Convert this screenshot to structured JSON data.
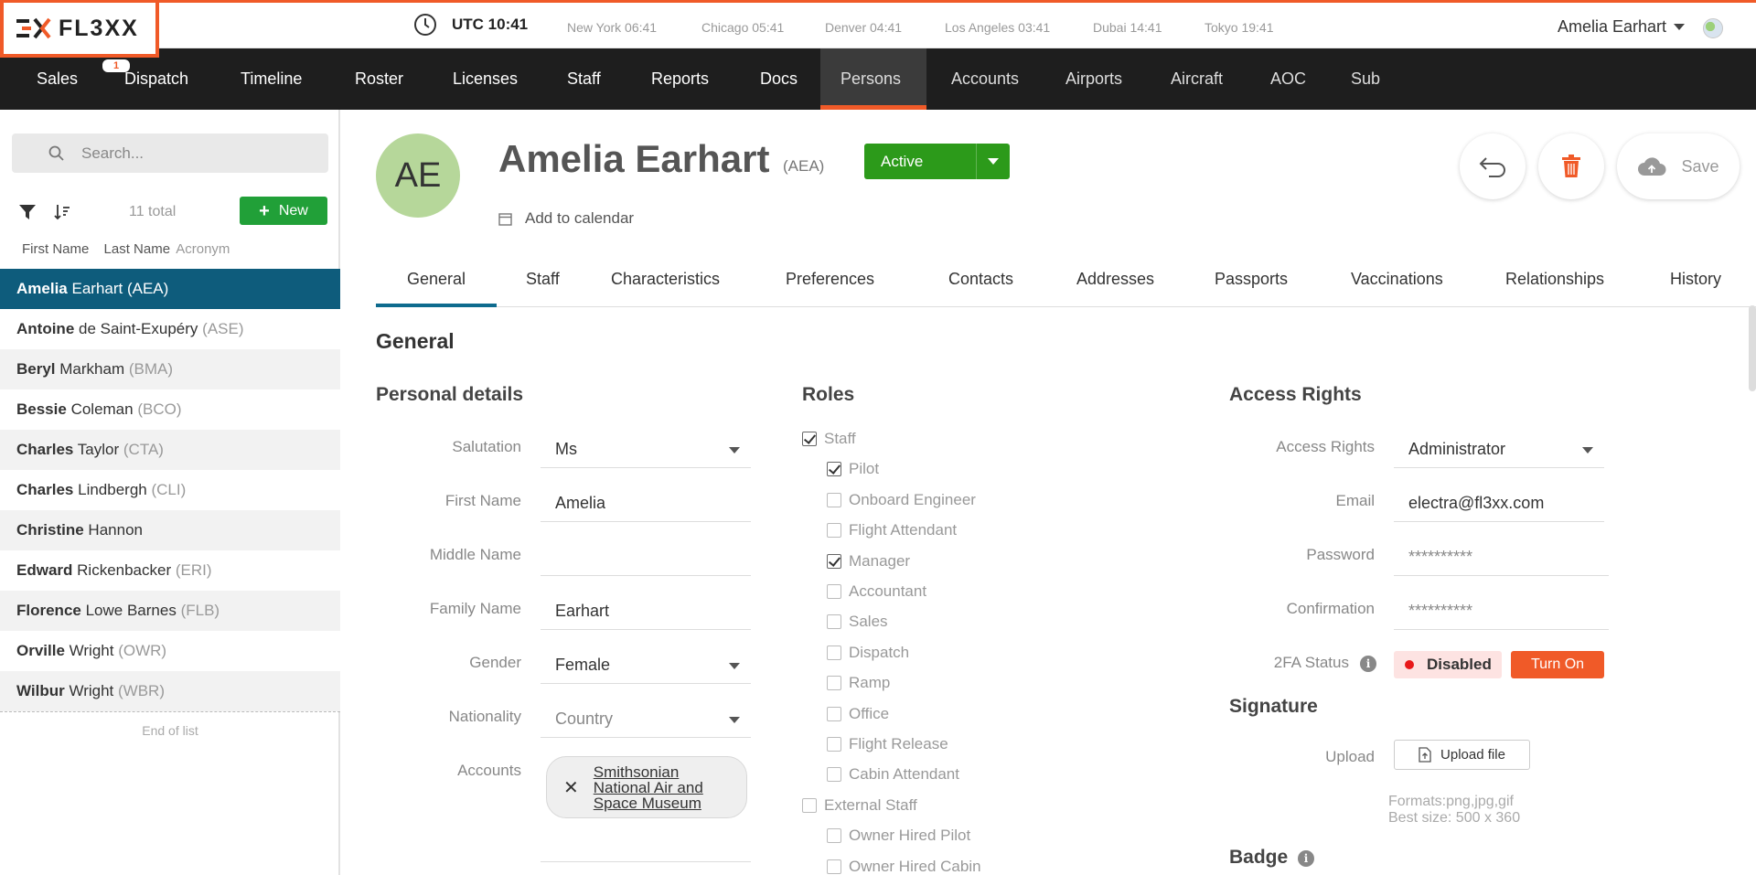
{
  "brand": {
    "logo_text": "FL3XX",
    "accent": "#f05a28"
  },
  "topbar": {
    "utc": "UTC 10:41",
    "timezones": [
      "New York 06:41",
      "Chicago 05:41",
      "Denver 04:41",
      "Los Angeles 03:41",
      "Dubai 14:41",
      "Tokyo 19:41"
    ],
    "user": "Amelia Earhart"
  },
  "nav": {
    "items": [
      "Sales",
      "Dispatch",
      "Timeline",
      "Roster",
      "Licenses",
      "Staff",
      "Reports",
      "Docs",
      "Persons",
      "Accounts",
      "Airports",
      "Aircraft",
      "AOC",
      "Sub"
    ],
    "active": "Persons",
    "sales_badge": "1"
  },
  "sidebar": {
    "search_placeholder": "Search...",
    "total": "11 total",
    "new_label": "New",
    "columns": [
      "First Name",
      "Last Name",
      "Acronym"
    ],
    "persons": [
      {
        "first": "Amelia",
        "last": "Earhart",
        "acronym": "(AEA)"
      },
      {
        "first": "Antoine",
        "last": "de Saint-Exupéry",
        "acronym": "(ASE)"
      },
      {
        "first": "Beryl",
        "last": "Markham",
        "acronym": "(BMA)"
      },
      {
        "first": "Bessie",
        "last": "Coleman",
        "acronym": "(BCO)"
      },
      {
        "first": "Charles",
        "last": "Taylor",
        "acronym": "(CTA)"
      },
      {
        "first": "Charles",
        "last": "Lindbergh",
        "acronym": "(CLI)"
      },
      {
        "first": "Christine",
        "last": "Hannon",
        "acronym": ""
      },
      {
        "first": "Edward",
        "last": "Rickenbacker",
        "acronym": "(ERI)"
      },
      {
        "first": "Florence",
        "last": "Lowe Barnes",
        "acronym": "(FLB)"
      },
      {
        "first": "Orville",
        "last": "Wright",
        "acronym": "(OWR)"
      },
      {
        "first": "Wilbur",
        "last": "Wright",
        "acronym": "(WBR)"
      }
    ],
    "end_label": "End of list"
  },
  "person": {
    "initials": "AE",
    "name": "Amelia Earhart",
    "acronym": "(AEA)",
    "status": "Active",
    "calendar_label": "Add to calendar",
    "save_label": "Save"
  },
  "tabs": [
    "General",
    "Staff",
    "Characteristics",
    "Preferences",
    "Contacts",
    "Addresses",
    "Passports",
    "Vaccinations",
    "Relationships",
    "History"
  ],
  "section_title": "General",
  "personal": {
    "title": "Personal details",
    "salutation_label": "Salutation",
    "salutation": "Ms",
    "first_name_label": "First Name",
    "first_name": "Amelia",
    "middle_name_label": "Middle Name",
    "middle_name": "",
    "family_name_label": "Family Name",
    "family_name": "Earhart",
    "gender_label": "Gender",
    "gender": "Female",
    "nationality_label": "Nationality",
    "nationality_placeholder": "Country",
    "accounts_label": "Accounts",
    "account": "Smithsonian National Air and Space Museum"
  },
  "roles": {
    "title": "Roles",
    "items": [
      {
        "label": "Staff",
        "checked": true,
        "indent": 0
      },
      {
        "label": "Pilot",
        "checked": true,
        "indent": 1
      },
      {
        "label": "Onboard Engineer",
        "checked": false,
        "indent": 1
      },
      {
        "label": "Flight Attendant",
        "checked": false,
        "indent": 1
      },
      {
        "label": "Manager",
        "checked": true,
        "indent": 1
      },
      {
        "label": "Accountant",
        "checked": false,
        "indent": 1
      },
      {
        "label": "Sales",
        "checked": false,
        "indent": 1
      },
      {
        "label": "Dispatch",
        "checked": false,
        "indent": 1
      },
      {
        "label": "Ramp",
        "checked": false,
        "indent": 1
      },
      {
        "label": "Office",
        "checked": false,
        "indent": 1
      },
      {
        "label": "Flight Release",
        "checked": false,
        "indent": 1
      },
      {
        "label": "Cabin Attendant",
        "checked": false,
        "indent": 1
      },
      {
        "label": "External Staff",
        "checked": false,
        "indent": 0
      },
      {
        "label": "Owner Hired Pilot",
        "checked": false,
        "indent": 1
      },
      {
        "label": "Owner Hired Cabin",
        "checked": false,
        "indent": 1
      }
    ]
  },
  "access": {
    "title": "Access Rights",
    "rights_label": "Access Rights",
    "rights": "Administrator",
    "email_label": "Email",
    "email": "electra@fl3xx.com",
    "password_label": "Password",
    "password": "**********",
    "confirm_label": "Confirmation",
    "confirm": "**********",
    "tfa_label": "2FA Status",
    "tfa_status": "Disabled",
    "tfa_button": "Turn On",
    "signature_title": "Signature",
    "upload_label": "Upload",
    "upload_button": "Upload file",
    "formats_line1": "Formats:png,jpg,gif",
    "formats_line2": "Best size: 500 x 360",
    "badge_title": "Badge"
  }
}
